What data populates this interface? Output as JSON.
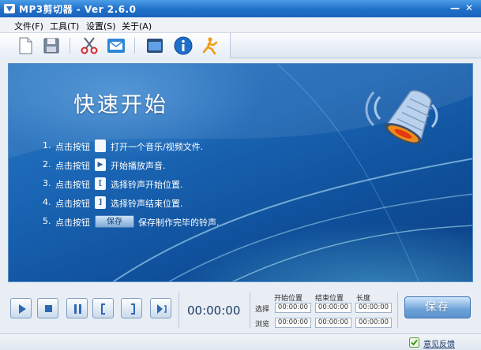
{
  "window": {
    "title": "MP3剪切器 - Ver 2.6.0",
    "minimize_label": "—",
    "close_label": "✕"
  },
  "menu": [
    {
      "label": "文件(F)"
    },
    {
      "label": "工具(T)"
    },
    {
      "label": "设置(S)"
    },
    {
      "label": "关于(A)"
    }
  ],
  "toolbar": {
    "buttons": [
      "new-file-icon",
      "save-disk-icon",
      "scissors-icon",
      "email-icon",
      "window-icon",
      "info-icon",
      "runner-icon"
    ]
  },
  "main": {
    "title": "快速开始",
    "steps": [
      {
        "num": "1.",
        "prefix": "点击按钮",
        "icon": "",
        "text": "打开一个音乐/视频文件."
      },
      {
        "num": "2.",
        "prefix": "点击按钮",
        "icon": "▶",
        "text": "开始播放声音."
      },
      {
        "num": "3.",
        "prefix": "点击按钮",
        "icon": "[",
        "text": "选择铃声开始位置."
      },
      {
        "num": "4.",
        "prefix": "点击按钮",
        "icon": "]",
        "text": "选择铃声结束位置."
      },
      {
        "num": "5.",
        "prefix": "点击按钮",
        "icon": "保存",
        "text": "保存制作完毕的铃声."
      }
    ]
  },
  "controls": {
    "time": "00:00:00",
    "headers": {
      "start": "开始位置",
      "end": "结束位置",
      "length": "长度"
    },
    "rows": [
      {
        "label": "选择",
        "start": "00:00:00",
        "end": "00:00:00",
        "length": "00:00:00"
      },
      {
        "label": "浏览",
        "start": "00:00:00",
        "end": "00:00:00",
        "length": "00:00:00"
      }
    ],
    "save_label": "保存"
  },
  "status": {
    "feedback_label": "意见反馈"
  },
  "colors": {
    "titlebar": "#1f6fc9",
    "main_bg": "#1a66b5",
    "accent": "#5b92cf"
  }
}
